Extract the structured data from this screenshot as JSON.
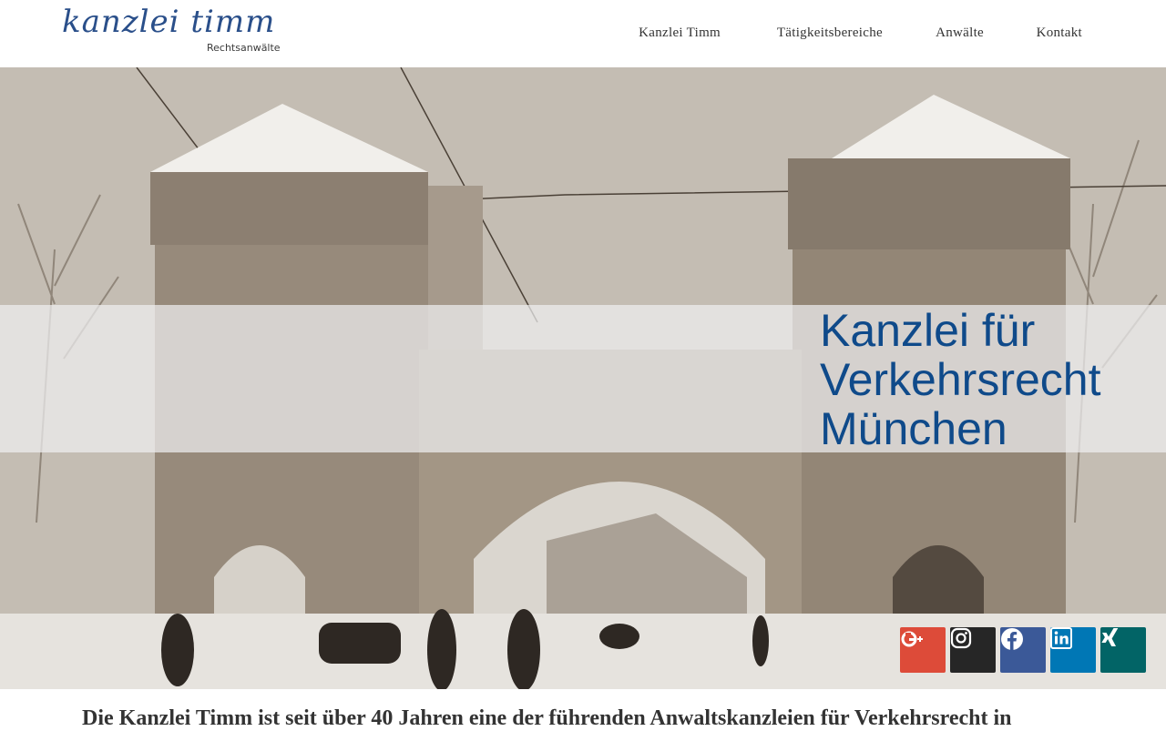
{
  "header": {
    "logo": {
      "script_text": "kanzlei timm",
      "subtitle": "Rechtsanwälte"
    },
    "nav": [
      {
        "label": "Kanzlei Timm"
      },
      {
        "label": "Tätigkeitsbereiche"
      },
      {
        "label": "Anwälte"
      },
      {
        "label": "Kontakt"
      }
    ]
  },
  "hero": {
    "headline_lines": [
      "Kanzlei für",
      "Verkehrsrecht",
      "München"
    ],
    "headline_color": "#0f4a8a"
  },
  "social": [
    {
      "name": "google-plus",
      "icon": "google-plus-icon",
      "color": "#dd4b39"
    },
    {
      "name": "instagram",
      "icon": "instagram-icon",
      "color": "#262626"
    },
    {
      "name": "facebook",
      "icon": "facebook-icon",
      "color": "#3b5998"
    },
    {
      "name": "linkedin",
      "icon": "linkedin-icon",
      "color": "#0077b5"
    },
    {
      "name": "xing",
      "icon": "xing-icon",
      "color": "#026466"
    }
  ],
  "intro": {
    "text": "Die Kanzlei Timm ist seit über 40 Jahren eine der führenden Anwaltskanzleien für Verkehrsrecht in"
  }
}
